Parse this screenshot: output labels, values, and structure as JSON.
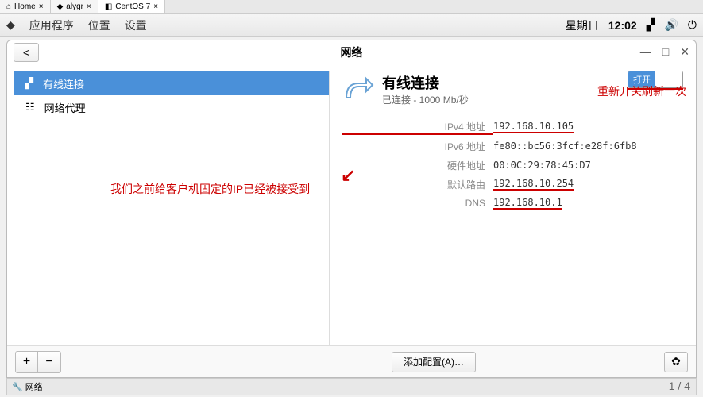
{
  "browser_tabs": {
    "home": "Home",
    "alygr": "alygr",
    "centos": "CentOS 7"
  },
  "topbar": {
    "apps": "应用程序",
    "location": "位置",
    "settings": "设置",
    "day": "星期日",
    "time": "12:02"
  },
  "window": {
    "title": "网络",
    "back": "<",
    "minimize": "—",
    "maximize": "□",
    "close": "✕"
  },
  "annotations": {
    "right_top": "重新开关刷新一次",
    "left_note": "我们之前给客户机固定的IP已经被接受到"
  },
  "sidebar": {
    "wired": "有线连接",
    "proxy": "网络代理"
  },
  "detail": {
    "title": "有线连接",
    "status": "已连接 - 1000 Mb/秒",
    "toggle_on": "打开",
    "rows": {
      "ipv4_label": "IPv4 地址",
      "ipv4_value": "192.168.10.105",
      "ipv6_label": "IPv6 地址",
      "ipv6_value": "fe80::bc56:3fcf:e28f:6fb8",
      "mac_label": "硬件地址",
      "mac_value": "00:0C:29:78:45:D7",
      "gw_label": "默认路由",
      "gw_value": "192.168.10.254",
      "dns_label": "DNS",
      "dns_value": "192.168.10.1"
    }
  },
  "buttons": {
    "plus": "+",
    "minus": "−",
    "add_config": "添加配置(A)…",
    "gear": "✿"
  },
  "statusbar": {
    "label": "网络"
  },
  "page": "1 / 4"
}
